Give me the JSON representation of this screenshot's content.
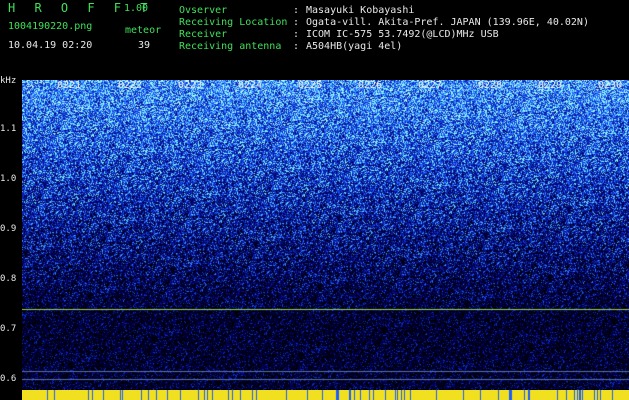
{
  "app": {
    "title": "H R O F F T",
    "version": "1.00"
  },
  "file": {
    "name": "1004190220.png",
    "datetime": "10.04.19 02:20"
  },
  "meteor": {
    "label": "meteor",
    "count": "39"
  },
  "info": [
    {
      "key": "Ovserver",
      "value": "Masayuki Kobayashi"
    },
    {
      "key": "Receiving Location",
      "value": "Ogata-vill. Akita-Pref. JAPAN (139.96E, 40.02N)"
    },
    {
      "key": "Receiver",
      "value": "ICOM IC-575 53.7492(@LCD)MHz USB"
    },
    {
      "key": "Receiving antenna",
      "value": "A504HB(yagi 4el)"
    }
  ],
  "info_sep": ":",
  "y_axis": {
    "unit": "kHz",
    "ticks": [
      "1.1",
      "1.0",
      "0.9",
      "0.8",
      "0.7",
      "0.6"
    ]
  },
  "time_labels": [
    "0221",
    "0222",
    "0223",
    "0224",
    "0225",
    "0226",
    "0227",
    "0228",
    "0229",
    "0230"
  ],
  "colors": {
    "text_green": "#3fe05a",
    "text_white": "#e8e8e8",
    "background": "#000000",
    "noise_dark": "#0a0e6a",
    "noise_bright": "#46e0ff",
    "carrier_line": "#9ad04a",
    "footer": "#f0e020"
  }
}
